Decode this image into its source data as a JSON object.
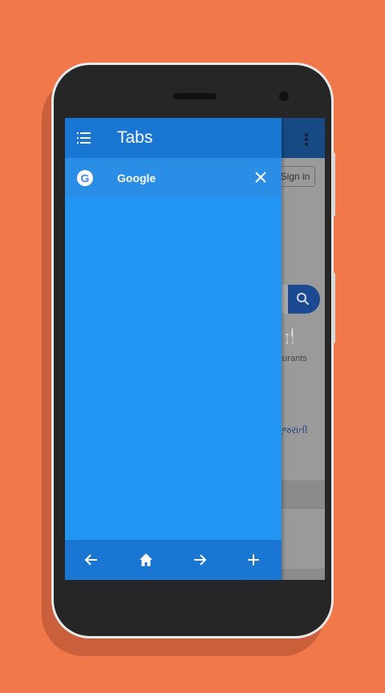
{
  "drawer": {
    "title": "Tabs",
    "menu_icon": "list-icon",
    "tabs": [
      {
        "title": "Google",
        "favicon_letter": "G",
        "favicon": "google-favicon-icon",
        "close_icon": "close-icon"
      }
    ],
    "footer_icons": [
      "back-arrow-icon",
      "home-icon",
      "forward-arrow-icon",
      "plus-icon"
    ]
  },
  "background_page": {
    "sign_in_label": "Sign in",
    "restaurants_label": "taurants",
    "language_link": "ગુજરાતી",
    "fork_glyph": "🍴"
  },
  "colors": {
    "page_background": "#F0784A",
    "drawer_blue": "#2196F3",
    "drawer_dark_blue": "#1976D2",
    "tab_row": "#2A8EE6",
    "toolbar_dimmed": "#174A85"
  }
}
